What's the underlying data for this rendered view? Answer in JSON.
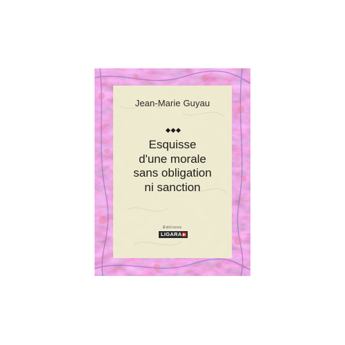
{
  "book": {
    "author": "Jean-Marie Guyau",
    "title_lines": [
      "Esquisse",
      "d'une morale",
      "sans obligation",
      "ni sanction"
    ],
    "publisher_small": "Éditions",
    "publisher_logo": "LIGARAN"
  },
  "colors": {
    "border": "#c85a78",
    "panel": "#f0ecd2",
    "text": "#1d1c1a",
    "ornament": "#1a1a1a",
    "logo_mark": "#d8322a"
  },
  "icons": {
    "ornament": "three-diamonds-ornament",
    "publisher_mark": "ligaran-red-square-mark"
  }
}
